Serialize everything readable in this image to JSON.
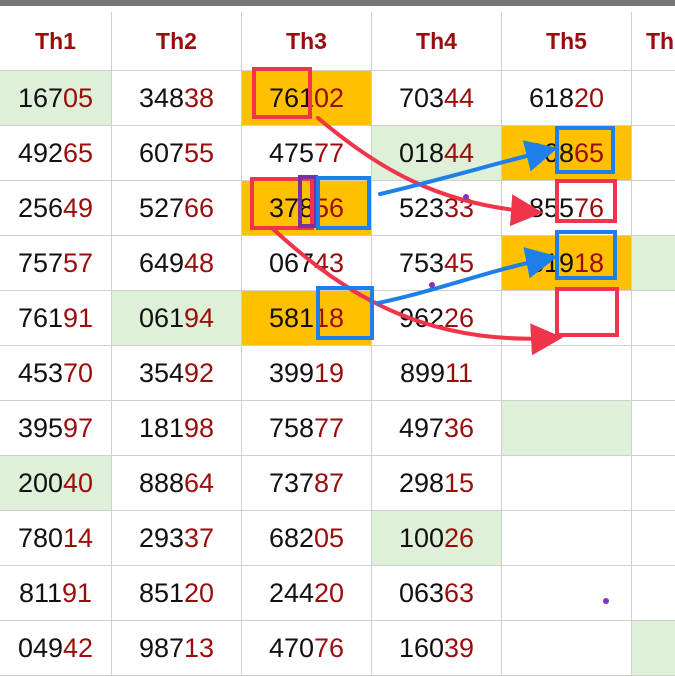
{
  "headers": [
    "Th1",
    "Th2",
    "Th3",
    "Th4",
    "Th5",
    "Th"
  ],
  "rows": [
    [
      "16705",
      "34838",
      "76102",
      "70344",
      "61820",
      ""
    ],
    [
      "49265",
      "60755",
      "47577",
      "01844",
      "00865",
      ""
    ],
    [
      "25649",
      "52766",
      "37856",
      "52333",
      "85576",
      ""
    ],
    [
      "75757",
      "64948",
      "06743",
      "75345",
      "81918",
      ""
    ],
    [
      "76191",
      "06194",
      "58118",
      "96226",
      "",
      ""
    ],
    [
      "45370",
      "35492",
      "39919",
      "89911",
      "",
      ""
    ],
    [
      "39597",
      "18198",
      "75877",
      "49736",
      "",
      ""
    ],
    [
      "20040",
      "88864",
      "73787",
      "29815",
      "",
      ""
    ],
    [
      "78014",
      "29337",
      "68205",
      "10026",
      "",
      ""
    ],
    [
      "81191",
      "85120",
      "24420",
      "06363",
      "",
      ""
    ],
    [
      "04942",
      "98713",
      "47076",
      "16039",
      "",
      ""
    ]
  ],
  "colors": {
    "header_text": "#9a0d0d",
    "suffix_text": "#9a0d0d",
    "highlight_orange": "#ffc000",
    "highlight_green": "#dff0d8",
    "annotation_red": "#f0344a",
    "annotation_blue": "#1e7fe8",
    "annotation_purple": "#7a2fa3"
  }
}
